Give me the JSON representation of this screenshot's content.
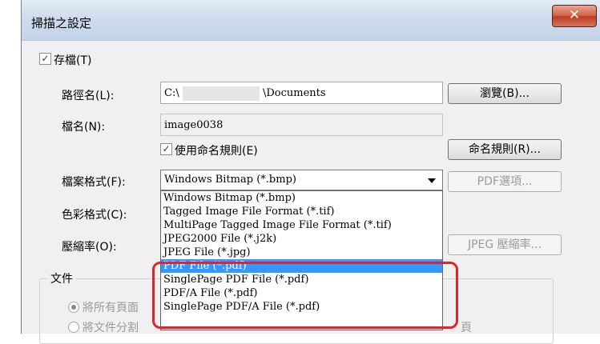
{
  "window": {
    "title": "掃描之設定",
    "close_label": "✕"
  },
  "save": {
    "checkbox_label": "存檔(T)",
    "path_label": "路徑名(L):",
    "path_value": "C:\\",
    "path_value_end": "\\Documents",
    "browse_button": "瀏覽(B)...",
    "filename_label": "檔名(N):",
    "filename_value": "image0038",
    "naming_rule_checkbox": "使用命名規則(E)",
    "naming_rule_button": "命名規則(R)...",
    "format_label": "檔案格式(F):",
    "format_value": "Windows Bitmap (*.bmp)",
    "pdf_options_button": "PDF選項...",
    "color_label": "色彩格式(C):",
    "compression_label": "壓縮率(O):",
    "jpeg_button": "JPEG 壓縮率..."
  },
  "format_options": [
    "Windows Bitmap (*.bmp)",
    "Tagged Image File Format (*.tif)",
    "MultiPage Tagged Image File Format (*.tif)",
    "JPEG2000 File (*.j2k)",
    "JPEG File (*.jpg)",
    "PDF File (*.pdf)",
    "SinglePage PDF File (*.pdf)",
    "PDF/A File (*.pdf)",
    "SinglePage PDF/A File (*.pdf)"
  ],
  "selected_option_index": 5,
  "document": {
    "group_label": "文件",
    "radio_all": "將所有頁面",
    "radio_split": "將文件分割",
    "radio_split_end": "頁"
  },
  "colors": {
    "highlight": "#e0242a",
    "selection": "#3399ff"
  }
}
